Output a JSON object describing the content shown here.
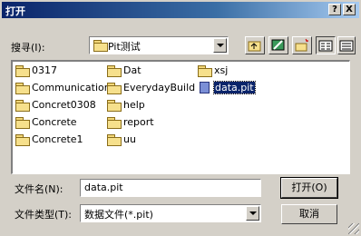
{
  "window": {
    "title": "打开",
    "help_button": "?",
    "close_button": "X"
  },
  "lookin": {
    "label": "搜寻(I):",
    "value": "Pit测试"
  },
  "toolbar": {
    "icons": [
      "up-one-level-icon",
      "desktop-icon",
      "new-folder-icon",
      "list-view-icon",
      "details-view-icon"
    ]
  },
  "files": [
    {
      "name": "0317",
      "type": "folder"
    },
    {
      "name": "Communication",
      "type": "folder"
    },
    {
      "name": "Concret0308",
      "type": "folder"
    },
    {
      "name": "Concrete",
      "type": "folder"
    },
    {
      "name": "Concrete1",
      "type": "folder"
    },
    {
      "name": "Dat",
      "type": "folder"
    },
    {
      "name": "EverydayBuild",
      "type": "folder"
    },
    {
      "name": "help",
      "type": "folder"
    },
    {
      "name": "report",
      "type": "folder"
    },
    {
      "name": "uu",
      "type": "folder"
    },
    {
      "name": "xsj",
      "type": "folder"
    },
    {
      "name": "data.pit",
      "type": "file",
      "selected": true
    }
  ],
  "filename": {
    "label": "文件名(N):",
    "value": "data.pit"
  },
  "filetype": {
    "label": "文件类型(T):",
    "value": "数据文件(*.pit)"
  },
  "buttons": {
    "open": "打开(O)",
    "cancel": "取消"
  },
  "colors": {
    "title_start": "#0a246a",
    "title_end": "#a6caf0",
    "face": "#d4d0c8",
    "selection": "#0a246a"
  }
}
